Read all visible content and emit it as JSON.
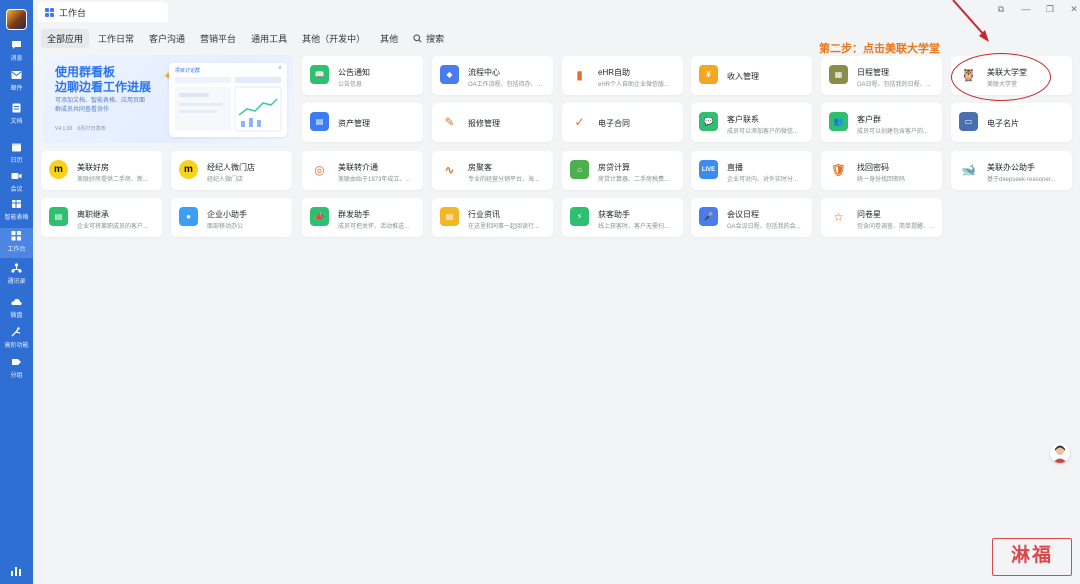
{
  "window": {
    "tab_title": "工作台",
    "controls": [
      "⧉",
      "—",
      "❐",
      "✕"
    ]
  },
  "rail": {
    "items": [
      {
        "label": "消息",
        "icon": "chat-icon"
      },
      {
        "label": "邮件",
        "icon": "mail-icon"
      },
      {
        "label": "文档",
        "icon": "doc-icon"
      },
      {
        "label": "日历",
        "icon": "calendar-icon"
      },
      {
        "label": "会议",
        "icon": "meeting-icon"
      },
      {
        "label": "智能表格",
        "icon": "sheet-icon"
      },
      {
        "label": "工作台",
        "icon": "workbench-icon",
        "active": true
      },
      {
        "label": "通讯录",
        "icon": "contacts-icon"
      },
      {
        "label": "微盘",
        "icon": "drive-icon"
      },
      {
        "label": "高阶功能",
        "icon": "advanced-icon"
      },
      {
        "label": "分组",
        "icon": "group-icon"
      }
    ]
  },
  "nav": {
    "tabs": [
      "全部应用",
      "工作日常",
      "客户沟通",
      "营销平台",
      "通用工具",
      "其他（开发中）",
      "其他"
    ],
    "active": "全部应用",
    "search_label": "搜索"
  },
  "banner": {
    "title_line1": "使用群看板",
    "title_line2": "边聊边看工作进展",
    "sub_line1": "可添加文档、智能表格、应用页面",
    "sub_line2": "群成员共同查看协作",
    "version": "V4.1.30　3月27日发布",
    "panel_title": "项目讨论群"
  },
  "apps": [
    {
      "name": "公告通知",
      "desc": "公告信息",
      "color": "#2fbf71",
      "glyph": "📖"
    },
    {
      "name": "流程中心",
      "desc": "OA工作流程、包括待办、抄送...",
      "color": "#4a7cf0",
      "glyph": "◆"
    },
    {
      "name": "eHR自助",
      "desc": "eHR个人自助企业微信版...",
      "color": "#ffffff",
      "glyph": "▮"
    },
    {
      "name": "收入管理",
      "desc": "",
      "color": "#f5a623",
      "glyph": "¥"
    },
    {
      "name": "日程管理",
      "desc": "OA日程、包括我的日程、...",
      "color": "#8a8d4a",
      "glyph": "▦"
    },
    {
      "name": "美联大学堂",
      "desc": "美联大学堂",
      "color": "#ffffff",
      "glyph": "🦉"
    },
    {
      "name": "资产管理",
      "desc": "",
      "color": "#3b7cf2",
      "glyph": "▤"
    },
    {
      "name": "报修管理",
      "desc": "",
      "color": "#ffffff",
      "glyph": "✎"
    },
    {
      "name": "电子合同",
      "desc": "",
      "color": "#ffffff",
      "glyph": "✓"
    },
    {
      "name": "客户联系",
      "desc": "成员可以添加客户的微信...",
      "color": "#2fbf71",
      "glyph": "💬"
    },
    {
      "name": "客户群",
      "desc": "成员可以创建包含客户的...",
      "color": "#2fbf71",
      "glyph": "👥"
    },
    {
      "name": "电子名片",
      "desc": "",
      "color": "#4a6fae",
      "glyph": "▭"
    },
    {
      "name": "美联好房",
      "desc": "美联好房提供二手房、新...",
      "color": "#f7d31b",
      "glyph": "m"
    },
    {
      "name": "经纪人微门店",
      "desc": "经纪人微门店",
      "color": "#f7d31b",
      "glyph": "m"
    },
    {
      "name": "美联转介通",
      "desc": "美联由始于1973年成立、...",
      "color": "#ffffff",
      "glyph": "◎"
    },
    {
      "name": "房聚客",
      "desc": "专业的经营分销平台、海...",
      "color": "#ffffff",
      "glyph": "∿"
    },
    {
      "name": "房贷计算",
      "desc": "房贷计算器、二手房税费...",
      "color": "#4caf50",
      "glyph": "⌂"
    },
    {
      "name": "直播",
      "desc": "企业可对内、对外实时分...",
      "color": "#3b8bf2",
      "glyph": "LIVE"
    },
    {
      "name": "找回密码",
      "desc": "统一身份找回密码",
      "color": "#ffffff",
      "glyph": "🛡"
    },
    {
      "name": "美联办公助手",
      "desc": "基于deepseek-reasoner...",
      "color": "#ffffff",
      "glyph": "🐋"
    },
    {
      "name": "离职继承",
      "desc": "企业可将离职成员的客户...",
      "color": "#2fbf71",
      "glyph": "▤"
    },
    {
      "name": "企业小助手",
      "desc": "面部移动办公",
      "color": "#3ba0f2",
      "glyph": "●"
    },
    {
      "name": "群发助手",
      "desc": "成员可把关怀、活动推送...",
      "color": "#2fbf71",
      "glyph": "📣"
    },
    {
      "name": "行业资讯",
      "desc": "在这里和同事一起阅读行...",
      "color": "#f5b623",
      "glyph": "▤"
    },
    {
      "name": "获客助手",
      "desc": "线上获客时、客户无需扫...",
      "color": "#2fbf71",
      "glyph": "⚡"
    },
    {
      "name": "会议日程",
      "desc": "OA会议日程、包括我的会...",
      "color": "#4a7cf0",
      "glyph": "🎤"
    },
    {
      "name": "问卷星",
      "desc": "包含问卷调查、简单提醒、考...",
      "color": "#ffffff",
      "glyph": "☆"
    }
  ],
  "annotation": {
    "text": "第二步：点击美联大学堂"
  },
  "watermark": {
    "text": "淋福"
  },
  "colors": {
    "rail": "#2f6fd4",
    "accent": "#3b7cf2",
    "annotation": "#e8771e",
    "circle": "#c8262c"
  }
}
